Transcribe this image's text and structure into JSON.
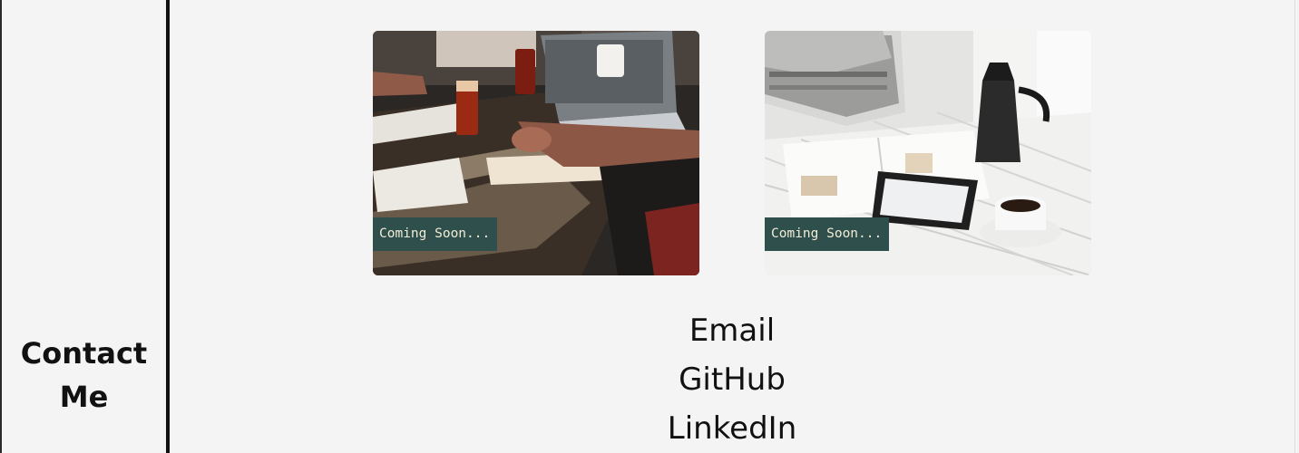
{
  "sidebar": {
    "heading_line1": "Contact",
    "heading_line2": "Me"
  },
  "projects": [
    {
      "badge": "Coming Soon...",
      "image": "team-workspace-table-photo"
    },
    {
      "badge": "Coming Soon...",
      "image": "coffee-tablet-magazines-photo"
    }
  ],
  "contact": {
    "links": [
      "Email",
      "GitHub",
      "LinkedIn"
    ]
  },
  "colors": {
    "background": "#f4f4f4",
    "divider": "#111111",
    "badge_bg": "#2f4f4c",
    "badge_text": "#f2ecd6"
  }
}
